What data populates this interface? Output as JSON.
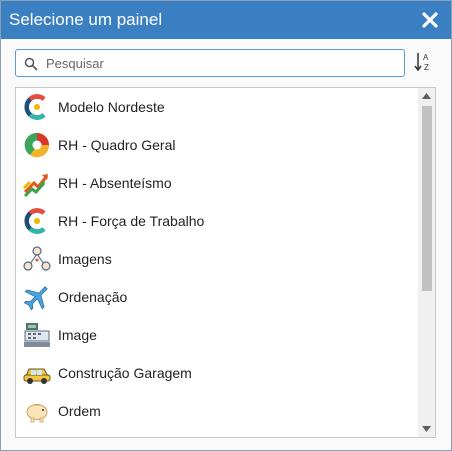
{
  "dialog": {
    "title": "Selecione um painel",
    "close_glyph": "✕"
  },
  "search": {
    "placeholder": "Pesquisar",
    "value": ""
  },
  "sort_icon": "sort-alpha-asc-icon",
  "items": [
    {
      "label": "Modelo Nordeste",
      "icon": "c-logo-icon"
    },
    {
      "label": "RH - Quadro Geral",
      "icon": "pie-chart-icon"
    },
    {
      "label": "RH - Absenteísmo",
      "icon": "trend-arrows-icon"
    },
    {
      "label": "RH - Força de Trabalho",
      "icon": "c-logo-icon"
    },
    {
      "label": "Imagens",
      "icon": "people-network-icon"
    },
    {
      "label": "Ordenação",
      "icon": "airplane-icon"
    },
    {
      "label": "Image",
      "icon": "cash-register-icon"
    },
    {
      "label": "Construção Garagem",
      "icon": "car-icon"
    },
    {
      "label": "Ordem",
      "icon": "piggy-bank-icon"
    }
  ]
}
